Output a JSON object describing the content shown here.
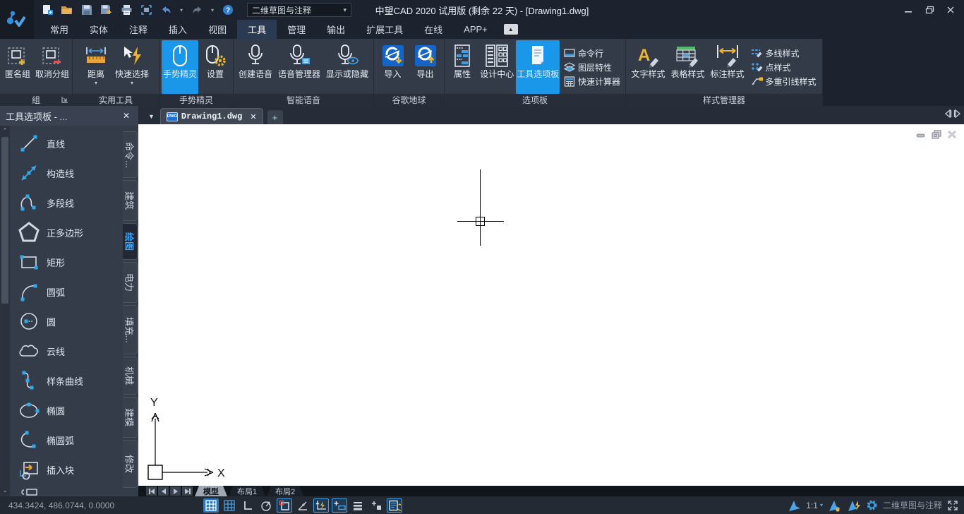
{
  "titlebar": {
    "title": "中望CAD 2020 试用版 (剩余 22 天) - [Drawing1.dwg]",
    "workspace_dropdown": "二维草图与注释"
  },
  "glyphs": {
    "caret_down": "▾",
    "dropdown": "▼",
    "close": "✕",
    "plus": "+",
    "collapse": "▲",
    "scroll_up": "▲",
    "scroll_down": "▼",
    "ellipsis_title": "工具选项板 - ..."
  },
  "ribbon": {
    "tabs": [
      "常用",
      "实体",
      "注释",
      "插入",
      "视图",
      "工具",
      "管理",
      "输出",
      "扩展工具",
      "在线",
      "APP+"
    ],
    "active_tab": "工具",
    "groups": {
      "g1": {
        "caption": "组",
        "b1": "匿名组",
        "b2": "取消分组"
      },
      "g2": {
        "caption": "实用工具",
        "b1": "距离",
        "b2": "快速选择"
      },
      "g3": {
        "caption": "手势精灵",
        "b1": "手势精灵",
        "b2": "设置"
      },
      "g4": {
        "caption": "智能语音",
        "b1": "创建语音",
        "b2": "语音管理器",
        "b3": "显示或隐藏"
      },
      "g5": {
        "caption": "谷歌地球",
        "b1": "导入",
        "b2": "导出"
      },
      "g6": {
        "caption": "选项板",
        "b1": "属性",
        "b2": "设计中心",
        "b3": "工具选项板",
        "s1": "命令行",
        "s2": "图层特性",
        "s3": "快速计算器"
      },
      "g7": {
        "caption": "样式管理器",
        "b1": "文字样式",
        "b2": "表格样式",
        "b3": "标注样式",
        "s1": "多线样式",
        "s2": "点样式",
        "s3": "多重引线样式"
      }
    }
  },
  "docbar": {
    "tab": "Drawing1.dwg",
    "icon_label": "DWG"
  },
  "palette": {
    "title": "工具选项板 - ...",
    "items": [
      "直线",
      "构造线",
      "多段线",
      "正多边形",
      "矩形",
      "圆弧",
      "圆",
      "云线",
      "样条曲线",
      "椭圆",
      "椭圆弧",
      "插入块"
    ],
    "tabs": [
      "命令...",
      "建筑",
      "绘图",
      "电力",
      "填充...",
      "机械",
      "建模",
      "修改"
    ],
    "active_tab": "绘图"
  },
  "canvas": {
    "ucs_x": "X",
    "ucs_y": "Y"
  },
  "layout": {
    "tabs": [
      "模型",
      "布局1",
      "布局2"
    ],
    "active": "模型"
  },
  "statusbar": {
    "coords": "434.3424, 486.0744, 0.0000",
    "scale": "1:1",
    "workspace": "二维草图与注释"
  }
}
